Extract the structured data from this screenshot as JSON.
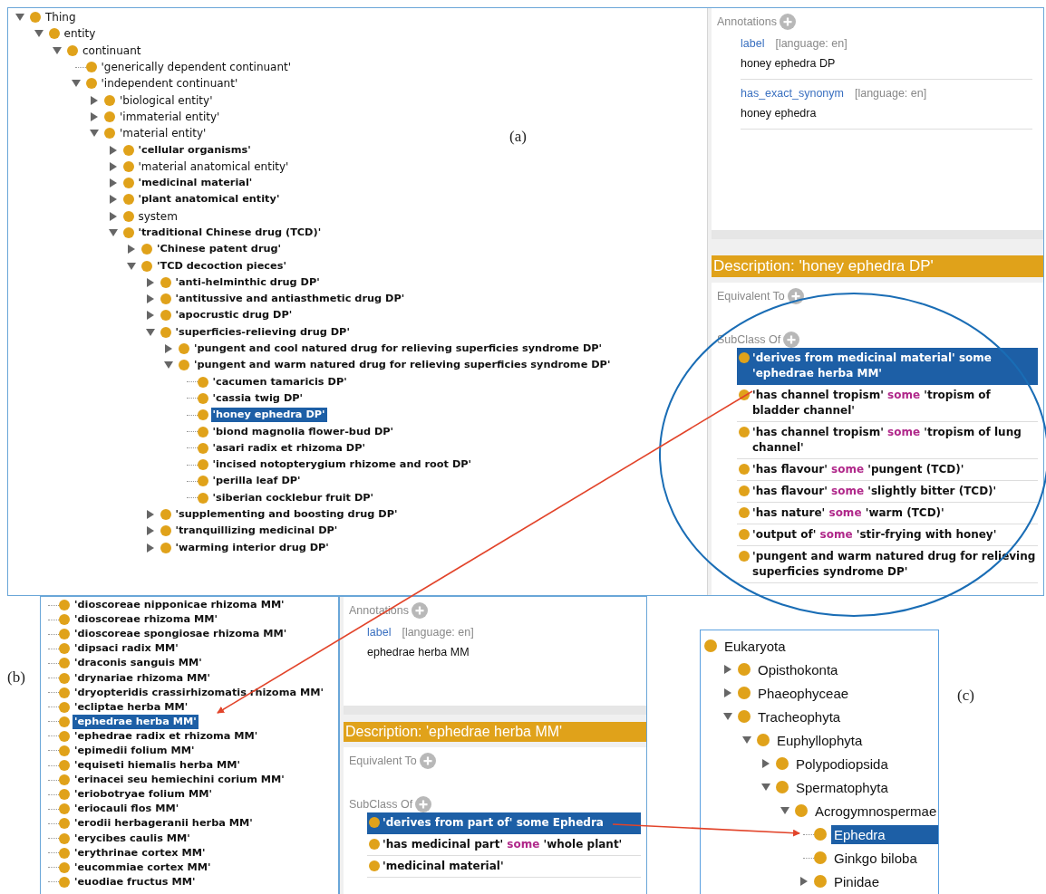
{
  "figure_a": {
    "caption": "(a)",
    "class_tree": [
      {
        "label": "Thing",
        "kind": "branch",
        "expanded": true,
        "bold": false,
        "selected": false,
        "children": [
          {
            "label": "entity",
            "kind": "branch",
            "expanded": true,
            "bold": false,
            "selected": false,
            "children": [
              {
                "label": "continuant",
                "kind": "branch",
                "expanded": true,
                "bold": false,
                "selected": false,
                "children": [
                  {
                    "label": "'generically dependent continuant'",
                    "kind": "leaf",
                    "expanded": false,
                    "bold": false,
                    "selected": false
                  },
                  {
                    "label": "'independent continuant'",
                    "kind": "branch",
                    "expanded": true,
                    "bold": false,
                    "selected": false,
                    "children": [
                      {
                        "label": "'biological entity'",
                        "kind": "branch",
                        "expanded": false,
                        "bold": false,
                        "selected": false
                      },
                      {
                        "label": "'immaterial entity'",
                        "kind": "branch",
                        "expanded": false,
                        "bold": false,
                        "selected": false
                      },
                      {
                        "label": "'material entity'",
                        "kind": "branch",
                        "expanded": true,
                        "bold": false,
                        "selected": false,
                        "children": [
                          {
                            "label": "'cellular organisms'",
                            "kind": "branch",
                            "expanded": false,
                            "bold": true,
                            "selected": false
                          },
                          {
                            "label": "'material anatomical entity'",
                            "kind": "branch",
                            "expanded": false,
                            "bold": false,
                            "selected": false
                          },
                          {
                            "label": "'medicinal material'",
                            "kind": "branch",
                            "expanded": false,
                            "bold": true,
                            "selected": false
                          },
                          {
                            "label": "'plant anatomical entity'",
                            "kind": "branch",
                            "expanded": false,
                            "bold": true,
                            "selected": false
                          },
                          {
                            "label": "system",
                            "kind": "branch",
                            "expanded": false,
                            "bold": false,
                            "selected": false
                          },
                          {
                            "label": "'traditional Chinese drug (TCD)'",
                            "kind": "branch",
                            "expanded": true,
                            "bold": true,
                            "selected": false,
                            "children": [
                              {
                                "label": "'Chinese patent drug'",
                                "kind": "branch",
                                "expanded": false,
                                "bold": true,
                                "selected": false
                              },
                              {
                                "label": "'TCD decoction pieces'",
                                "kind": "branch",
                                "expanded": true,
                                "bold": true,
                                "selected": false,
                                "children": [
                                  {
                                    "label": "'anti-helminthic drug DP'",
                                    "kind": "branch",
                                    "expanded": false,
                                    "bold": true,
                                    "selected": false
                                  },
                                  {
                                    "label": "'antitussive and antiasthmetic drug DP'",
                                    "kind": "branch",
                                    "expanded": false,
                                    "bold": true,
                                    "selected": false
                                  },
                                  {
                                    "label": "'apocrustic drug DP'",
                                    "kind": "branch",
                                    "expanded": false,
                                    "bold": true,
                                    "selected": false
                                  },
                                  {
                                    "label": "'superficies-relieving drug DP'",
                                    "kind": "branch",
                                    "expanded": true,
                                    "bold": true,
                                    "selected": false,
                                    "children": [
                                      {
                                        "label": "'pungent and cool natured drug for relieving superficies syndrome DP'",
                                        "kind": "branch",
                                        "expanded": false,
                                        "bold": true,
                                        "selected": false
                                      },
                                      {
                                        "label": "'pungent and warm natured drug for relieving superficies syndrome DP'",
                                        "kind": "branch",
                                        "expanded": true,
                                        "bold": true,
                                        "selected": false,
                                        "children": [
                                          {
                                            "label": "'cacumen tamaricis DP'",
                                            "kind": "leaf",
                                            "expanded": false,
                                            "bold": true,
                                            "selected": false
                                          },
                                          {
                                            "label": "'cassia twig DP'",
                                            "kind": "leaf",
                                            "expanded": false,
                                            "bold": true,
                                            "selected": false
                                          },
                                          {
                                            "label": "'honey ephedra DP'",
                                            "kind": "leaf",
                                            "expanded": false,
                                            "bold": true,
                                            "selected": true
                                          },
                                          {
                                            "label": "'biond magnolia flower-bud DP'",
                                            "kind": "leaf",
                                            "expanded": false,
                                            "bold": true,
                                            "selected": false
                                          },
                                          {
                                            "label": "'asari radix et rhizoma DP'",
                                            "kind": "leaf",
                                            "expanded": false,
                                            "bold": true,
                                            "selected": false
                                          },
                                          {
                                            "label": "'incised notopterygium rhizome and root DP'",
                                            "kind": "leaf",
                                            "expanded": false,
                                            "bold": true,
                                            "selected": false
                                          },
                                          {
                                            "label": "'perilla leaf DP'",
                                            "kind": "leaf",
                                            "expanded": false,
                                            "bold": true,
                                            "selected": false
                                          },
                                          {
                                            "label": "'siberian cocklebur fruit DP'",
                                            "kind": "leaf",
                                            "expanded": false,
                                            "bold": true,
                                            "selected": false
                                          }
                                        ]
                                      }
                                    ]
                                  },
                                  {
                                    "label": "'supplementing and boosting drug DP'",
                                    "kind": "branch",
                                    "expanded": false,
                                    "bold": true,
                                    "selected": false
                                  },
                                  {
                                    "label": "'tranquillizing medicinal DP'",
                                    "kind": "branch",
                                    "expanded": false,
                                    "bold": true,
                                    "selected": false
                                  },
                                  {
                                    "label": "'warming interior drug DP'",
                                    "kind": "branch",
                                    "expanded": false,
                                    "bold": true,
                                    "selected": false
                                  }
                                ]
                              }
                            ]
                          }
                        ]
                      }
                    ]
                  }
                ]
              }
            ]
          }
        ]
      }
    ],
    "annotations": {
      "title": "Annotations",
      "items": [
        {
          "property": "label",
          "language": "[language: en]",
          "value": "honey ephedra DP"
        },
        {
          "property": "has_exact_synonym",
          "language": "[language: en]",
          "value": "honey ephedra"
        }
      ]
    },
    "description": {
      "title": "Description: 'honey ephedra DP'",
      "equivalent_to": "Equivalent To",
      "subclass_of": "SubClass Of",
      "superclasses": [
        {
          "selected": true,
          "parts": [
            {
              "kind": "term",
              "text": "'derives from medicinal material'"
            },
            {
              "kind": "keyword",
              "text": "some"
            },
            {
              "kind": "term",
              "text": "'ephedrae herba MM'"
            }
          ]
        },
        {
          "selected": false,
          "parts": [
            {
              "kind": "term",
              "text": "'has channel tropism'"
            },
            {
              "kind": "keyword",
              "text": "some"
            },
            {
              "kind": "term",
              "text": "'tropism of bladder channel'"
            }
          ]
        },
        {
          "selected": false,
          "parts": [
            {
              "kind": "term",
              "text": "'has channel tropism'"
            },
            {
              "kind": "keyword",
              "text": "some"
            },
            {
              "kind": "term",
              "text": "'tropism of lung channel'"
            }
          ]
        },
        {
          "selected": false,
          "parts": [
            {
              "kind": "term",
              "text": "'has flavour'"
            },
            {
              "kind": "keyword",
              "text": "some"
            },
            {
              "kind": "term",
              "text": "'pungent (TCD)'"
            }
          ]
        },
        {
          "selected": false,
          "parts": [
            {
              "kind": "term",
              "text": "'has flavour'"
            },
            {
              "kind": "keyword",
              "text": "some"
            },
            {
              "kind": "term",
              "text": "'slightly bitter (TCD)'"
            }
          ]
        },
        {
          "selected": false,
          "parts": [
            {
              "kind": "term",
              "text": "'has nature'"
            },
            {
              "kind": "keyword",
              "text": "some"
            },
            {
              "kind": "term",
              "text": "'warm (TCD)'"
            }
          ]
        },
        {
          "selected": false,
          "parts": [
            {
              "kind": "term",
              "text": "'output of'"
            },
            {
              "kind": "keyword",
              "text": "some"
            },
            {
              "kind": "term",
              "text": "'stir-frying with honey'"
            }
          ]
        },
        {
          "selected": false,
          "parts": [
            {
              "kind": "term",
              "text": "'pungent and warm natured drug for relieving superficies syndrome DP'"
            }
          ]
        }
      ]
    }
  },
  "figure_b": {
    "caption": "(b)",
    "class_list": [
      {
        "label": "'dioscoreae nipponicae rhizoma MM'",
        "selected": false
      },
      {
        "label": "'dioscoreae rhizoma MM'",
        "selected": false
      },
      {
        "label": "'dioscoreae spongiosae rhizoma MM'",
        "selected": false
      },
      {
        "label": "'dipsaci radix MM'",
        "selected": false
      },
      {
        "label": "'draconis sanguis MM'",
        "selected": false
      },
      {
        "label": "'drynariae rhizoma MM'",
        "selected": false
      },
      {
        "label": "'dryopteridis crassirhizomatis rhizoma MM'",
        "selected": false
      },
      {
        "label": "'ecliptae herba MM'",
        "selected": false
      },
      {
        "label": "'ephedrae herba MM'",
        "selected": true
      },
      {
        "label": "'ephedrae radix et rhizoma MM'",
        "selected": false
      },
      {
        "label": "'epimedii folium MM'",
        "selected": false
      },
      {
        "label": "'equiseti hiemalis herba MM'",
        "selected": false
      },
      {
        "label": "'erinacei seu hemiechini corium MM'",
        "selected": false
      },
      {
        "label": "'eriobotryae folium MM'",
        "selected": false
      },
      {
        "label": "'eriocauli flos MM'",
        "selected": false
      },
      {
        "label": "'erodii herbageranii herba MM'",
        "selected": false
      },
      {
        "label": "'erycibes caulis MM'",
        "selected": false
      },
      {
        "label": "'erythrinae cortex MM'",
        "selected": false
      },
      {
        "label": "'eucommiae cortex MM'",
        "selected": false
      },
      {
        "label": "'euodiae fructus MM'",
        "selected": false
      }
    ],
    "annotations": {
      "title": "Annotations",
      "items": [
        {
          "property": "label",
          "language": "[language: en]",
          "value": "ephedrae herba MM"
        }
      ]
    },
    "description": {
      "title": "Description: 'ephedrae herba MM'",
      "equivalent_to": "Equivalent To",
      "subclass_of": "SubClass Of",
      "superclasses": [
        {
          "selected": true,
          "parts": [
            {
              "kind": "term",
              "text": "'derives from part of'"
            },
            {
              "kind": "plain",
              "text": "some Ephedra"
            }
          ]
        },
        {
          "selected": false,
          "parts": [
            {
              "kind": "term",
              "text": "'has medicinal part'"
            },
            {
              "kind": "keyword",
              "text": "some"
            },
            {
              "kind": "term",
              "text": "'whole plant'"
            }
          ]
        },
        {
          "selected": false,
          "parts": [
            {
              "kind": "term",
              "text": "'medicinal material'"
            }
          ]
        }
      ]
    }
  },
  "figure_c": {
    "caption": "(c)",
    "taxon_tree": [
      {
        "label": "Eukaryota",
        "kind": "root",
        "selected": false,
        "children": [
          {
            "label": "Opisthokonta",
            "kind": "branch",
            "expanded": false,
            "selected": false
          },
          {
            "label": "Phaeophyceae",
            "kind": "branch",
            "expanded": false,
            "selected": false
          },
          {
            "label": "Tracheophyta",
            "kind": "branch",
            "expanded": true,
            "selected": false,
            "children": [
              {
                "label": "Euphyllophyta",
                "kind": "branch",
                "expanded": true,
                "selected": false,
                "children": [
                  {
                    "label": "Polypodiopsida",
                    "kind": "branch",
                    "expanded": false,
                    "selected": false
                  },
                  {
                    "label": "Spermatophyta",
                    "kind": "branch",
                    "expanded": true,
                    "selected": false,
                    "children": [
                      {
                        "label": "Acrogymnospermae",
                        "kind": "branch",
                        "expanded": true,
                        "selected": false,
                        "children": [
                          {
                            "label": "Ephedra",
                            "kind": "leaf",
                            "expanded": false,
                            "selected": true
                          },
                          {
                            "label": "Ginkgo biloba",
                            "kind": "leaf",
                            "expanded": false,
                            "selected": false
                          },
                          {
                            "label": "Pinidae",
                            "kind": "branch",
                            "expanded": false,
                            "selected": false
                          }
                        ]
                      }
                    ]
                  }
                ]
              }
            ]
          }
        ]
      }
    ]
  }
}
